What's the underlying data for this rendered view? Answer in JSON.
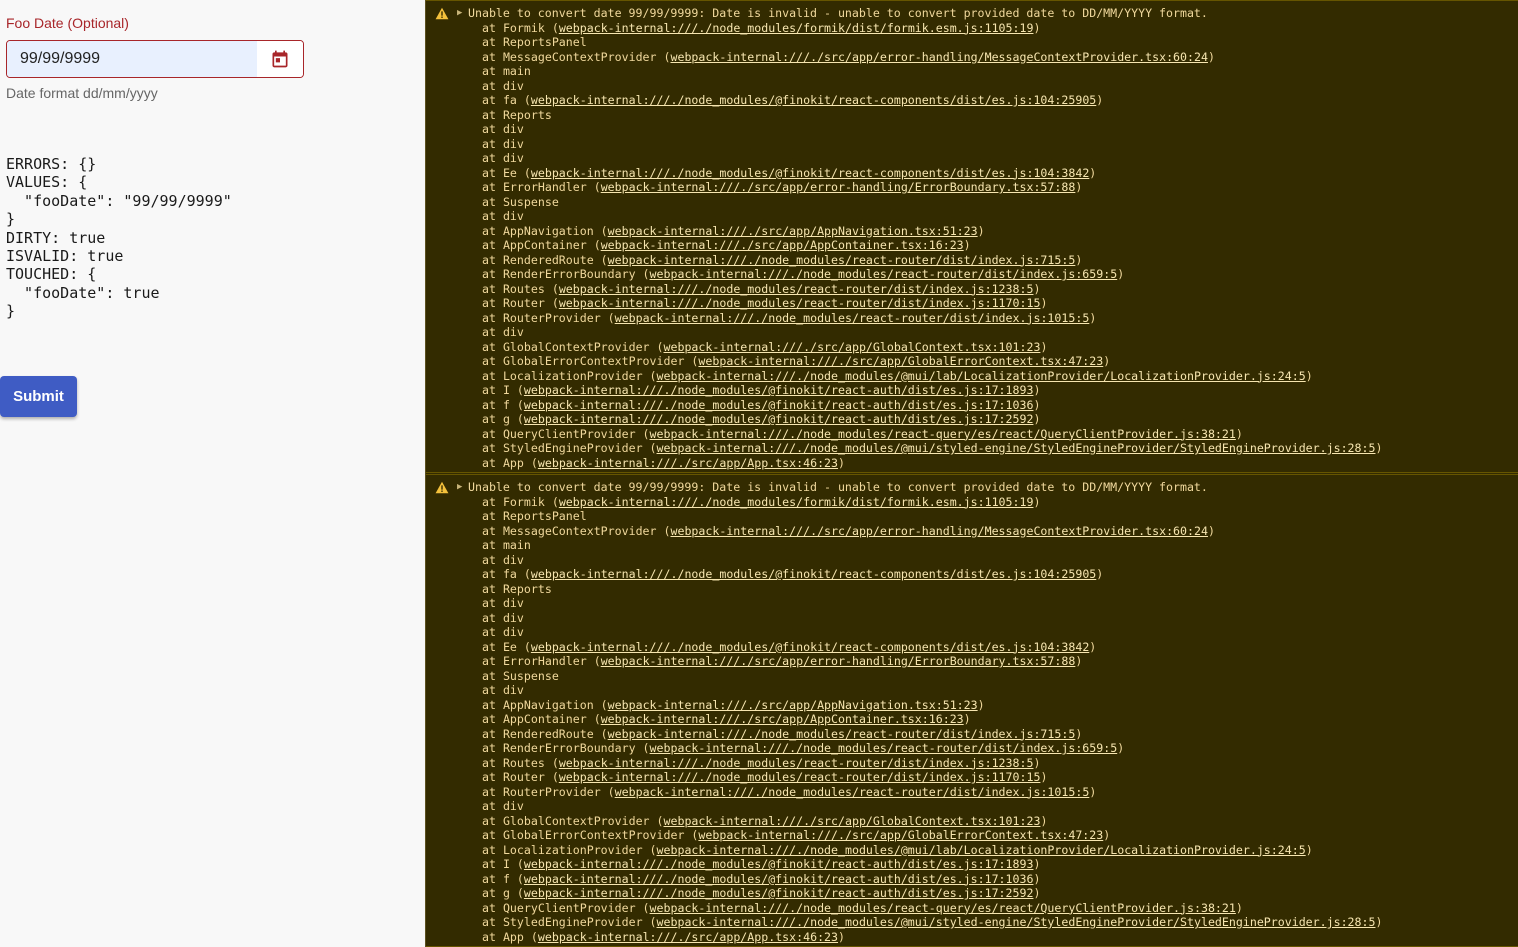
{
  "form": {
    "field_label": "Foo Date (Optional)",
    "date_value": "99/99/9999",
    "helper_text": "Date format dd/mm/yyyy",
    "debug_text": "ERRORS: {}\nVALUES: {\n  \"fooDate\": \"99/99/9999\"\n}\nDIRTY: true\nISVALID: true\nTOUCHED: {\n  \"fooDate\": true\n}",
    "submit_label": "Submit",
    "calendar_icon": "calendar-icon"
  },
  "colors": {
    "error_red": "#a8262a",
    "primary_button": "#3f5cc4",
    "console_bg": "#332b00",
    "console_text": "#f0d89c"
  },
  "console": {
    "entries": [
      {
        "message": "Unable to convert date 99/99/9999: Date is invalid - unable to convert provided date to DD/MM/YYYY format.",
        "icon": "warning-icon",
        "frames": [
          {
            "fn": "Formik",
            "loc": "webpack-internal:///./node_modules/formik/dist/formik.esm.js:1105:19"
          },
          {
            "fn": "ReportsPanel",
            "loc": ""
          },
          {
            "fn": "MessageContextProvider",
            "loc": "webpack-internal:///./src/app/error-handling/MessageContextProvider.tsx:60:24"
          },
          {
            "fn": "main",
            "loc": ""
          },
          {
            "fn": "div",
            "loc": ""
          },
          {
            "fn": "fa",
            "loc": "webpack-internal:///./node_modules/@finokit/react-components/dist/es.js:104:25905"
          },
          {
            "fn": "Reports",
            "loc": ""
          },
          {
            "fn": "div",
            "loc": ""
          },
          {
            "fn": "div",
            "loc": ""
          },
          {
            "fn": "div",
            "loc": ""
          },
          {
            "fn": "Ee",
            "loc": "webpack-internal:///./node_modules/@finokit/react-components/dist/es.js:104:3842"
          },
          {
            "fn": "ErrorHandler",
            "loc": "webpack-internal:///./src/app/error-handling/ErrorBoundary.tsx:57:88"
          },
          {
            "fn": "Suspense",
            "loc": ""
          },
          {
            "fn": "div",
            "loc": ""
          },
          {
            "fn": "AppNavigation",
            "loc": "webpack-internal:///./src/app/AppNavigation.tsx:51:23"
          },
          {
            "fn": "AppContainer",
            "loc": "webpack-internal:///./src/app/AppContainer.tsx:16:23"
          },
          {
            "fn": "RenderedRoute",
            "loc": "webpack-internal:///./node_modules/react-router/dist/index.js:715:5"
          },
          {
            "fn": "RenderErrorBoundary",
            "loc": "webpack-internal:///./node_modules/react-router/dist/index.js:659:5"
          },
          {
            "fn": "Routes",
            "loc": "webpack-internal:///./node_modules/react-router/dist/index.js:1238:5"
          },
          {
            "fn": "Router",
            "loc": "webpack-internal:///./node_modules/react-router/dist/index.js:1170:15"
          },
          {
            "fn": "RouterProvider",
            "loc": "webpack-internal:///./node_modules/react-router/dist/index.js:1015:5"
          },
          {
            "fn": "div",
            "loc": ""
          },
          {
            "fn": "GlobalContextProvider",
            "loc": "webpack-internal:///./src/app/GlobalContext.tsx:101:23"
          },
          {
            "fn": "GlobalErrorContextProvider",
            "loc": "webpack-internal:///./src/app/GlobalErrorContext.tsx:47:23"
          },
          {
            "fn": "LocalizationProvider",
            "loc": "webpack-internal:///./node_modules/@mui/lab/LocalizationProvider/LocalizationProvider.js:24:5"
          },
          {
            "fn": "I",
            "loc": "webpack-internal:///./node_modules/@finokit/react-auth/dist/es.js:17:1893"
          },
          {
            "fn": "f",
            "loc": "webpack-internal:///./node_modules/@finokit/react-auth/dist/es.js:17:1036"
          },
          {
            "fn": "g",
            "loc": "webpack-internal:///./node_modules/@finokit/react-auth/dist/es.js:17:2592"
          },
          {
            "fn": "QueryClientProvider",
            "loc": "webpack-internal:///./node_modules/react-query/es/react/QueryClientProvider.js:38:21"
          },
          {
            "fn": "StyledEngineProvider",
            "loc": "webpack-internal:///./node_modules/@mui/styled-engine/StyledEngineProvider/StyledEngineProvider.js:28:5"
          },
          {
            "fn": "App",
            "loc": "webpack-internal:///./src/app/App.tsx:46:23"
          }
        ]
      },
      {
        "message": "Unable to convert date 99/99/9999: Date is invalid - unable to convert provided date to DD/MM/YYYY format.",
        "icon": "warning-icon",
        "frames": [
          {
            "fn": "Formik",
            "loc": "webpack-internal:///./node_modules/formik/dist/formik.esm.js:1105:19"
          },
          {
            "fn": "ReportsPanel",
            "loc": ""
          },
          {
            "fn": "MessageContextProvider",
            "loc": "webpack-internal:///./src/app/error-handling/MessageContextProvider.tsx:60:24"
          },
          {
            "fn": "main",
            "loc": ""
          },
          {
            "fn": "div",
            "loc": ""
          },
          {
            "fn": "fa",
            "loc": "webpack-internal:///./node_modules/@finokit/react-components/dist/es.js:104:25905"
          },
          {
            "fn": "Reports",
            "loc": ""
          },
          {
            "fn": "div",
            "loc": ""
          },
          {
            "fn": "div",
            "loc": ""
          },
          {
            "fn": "div",
            "loc": ""
          },
          {
            "fn": "Ee",
            "loc": "webpack-internal:///./node_modules/@finokit/react-components/dist/es.js:104:3842"
          },
          {
            "fn": "ErrorHandler",
            "loc": "webpack-internal:///./src/app/error-handling/ErrorBoundary.tsx:57:88"
          },
          {
            "fn": "Suspense",
            "loc": ""
          },
          {
            "fn": "div",
            "loc": ""
          },
          {
            "fn": "AppNavigation",
            "loc": "webpack-internal:///./src/app/AppNavigation.tsx:51:23"
          },
          {
            "fn": "AppContainer",
            "loc": "webpack-internal:///./src/app/AppContainer.tsx:16:23"
          },
          {
            "fn": "RenderedRoute",
            "loc": "webpack-internal:///./node_modules/react-router/dist/index.js:715:5"
          },
          {
            "fn": "RenderErrorBoundary",
            "loc": "webpack-internal:///./node_modules/react-router/dist/index.js:659:5"
          },
          {
            "fn": "Routes",
            "loc": "webpack-internal:///./node_modules/react-router/dist/index.js:1238:5"
          },
          {
            "fn": "Router",
            "loc": "webpack-internal:///./node_modules/react-router/dist/index.js:1170:15"
          },
          {
            "fn": "RouterProvider",
            "loc": "webpack-internal:///./node_modules/react-router/dist/index.js:1015:5"
          },
          {
            "fn": "div",
            "loc": ""
          },
          {
            "fn": "GlobalContextProvider",
            "loc": "webpack-internal:///./src/app/GlobalContext.tsx:101:23"
          },
          {
            "fn": "GlobalErrorContextProvider",
            "loc": "webpack-internal:///./src/app/GlobalErrorContext.tsx:47:23"
          },
          {
            "fn": "LocalizationProvider",
            "loc": "webpack-internal:///./node_modules/@mui/lab/LocalizationProvider/LocalizationProvider.js:24:5"
          },
          {
            "fn": "I",
            "loc": "webpack-internal:///./node_modules/@finokit/react-auth/dist/es.js:17:1893"
          },
          {
            "fn": "f",
            "loc": "webpack-internal:///./node_modules/@finokit/react-auth/dist/es.js:17:1036"
          },
          {
            "fn": "g",
            "loc": "webpack-internal:///./node_modules/@finokit/react-auth/dist/es.js:17:2592"
          },
          {
            "fn": "QueryClientProvider",
            "loc": "webpack-internal:///./node_modules/react-query/es/react/QueryClientProvider.js:38:21"
          },
          {
            "fn": "StyledEngineProvider",
            "loc": "webpack-internal:///./node_modules/@mui/styled-engine/StyledEngineProvider/StyledEngineProvider.js:28:5"
          },
          {
            "fn": "App",
            "loc": "webpack-internal:///./src/app/App.tsx:46:23"
          }
        ]
      }
    ]
  }
}
